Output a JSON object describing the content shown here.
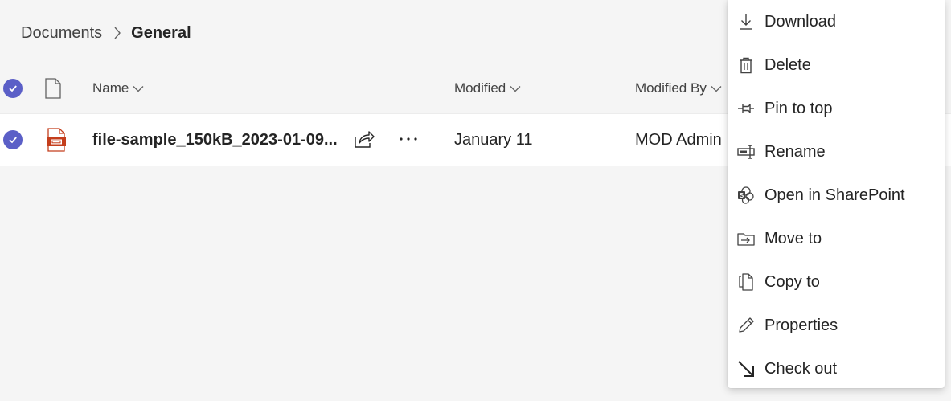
{
  "breadcrumb": {
    "root": "Documents",
    "current": "General"
  },
  "columns": {
    "name": "Name",
    "modified": "Modified",
    "modified_by": "Modified By"
  },
  "file": {
    "name": "file-sample_150kB_2023-01-09...",
    "modified": "January 11",
    "modified_by": "MOD Admin"
  },
  "menu": {
    "items": [
      {
        "label": "Download",
        "icon": "download-icon"
      },
      {
        "label": "Delete",
        "icon": "delete-icon"
      },
      {
        "label": "Pin to top",
        "icon": "pin-icon"
      },
      {
        "label": "Rename",
        "icon": "rename-icon"
      },
      {
        "label": "Open in SharePoint",
        "icon": "sharepoint-icon"
      },
      {
        "label": "Move to",
        "icon": "move-to-icon"
      },
      {
        "label": "Copy to",
        "icon": "copy-to-icon"
      },
      {
        "label": "Properties",
        "icon": "properties-icon"
      },
      {
        "label": "Check out",
        "icon": "check-out-icon"
      }
    ]
  },
  "colors": {
    "accent": "#5b5fc7",
    "file_icon": "#c43e1c",
    "background": "#f5f5f5"
  }
}
